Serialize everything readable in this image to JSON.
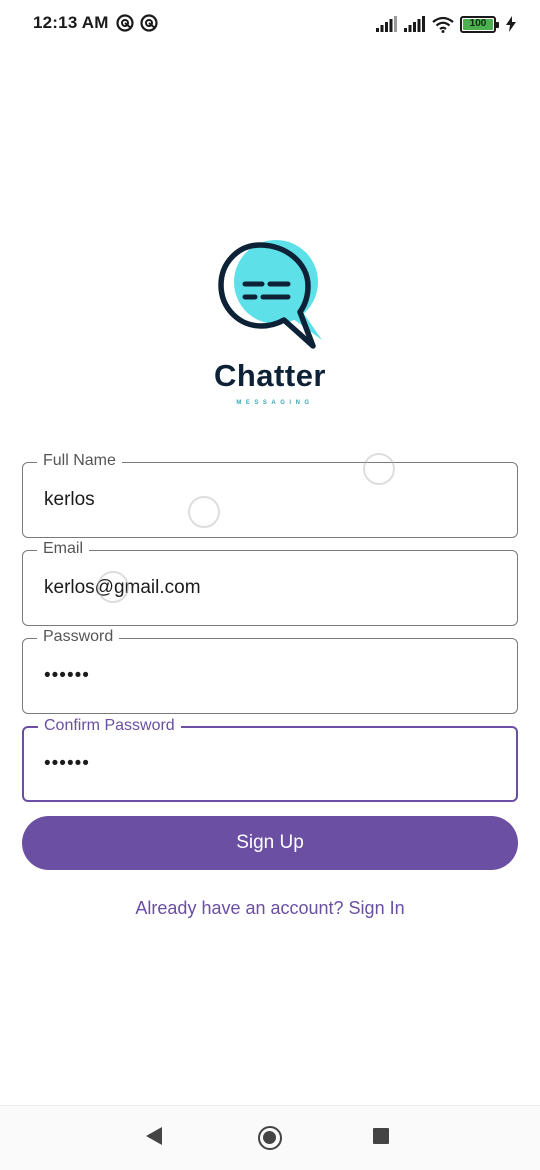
{
  "status_bar": {
    "time": "12:13 AM",
    "battery_level": "100",
    "icons": [
      "notification-icon",
      "notification-icon",
      "signal-icon",
      "signal-icon",
      "wifi-icon",
      "battery-icon",
      "charging-icon"
    ]
  },
  "logo": {
    "name": "Chatter",
    "tagline": "MESSAGING",
    "colors": {
      "bubble": "#5ee0e8",
      "outline": "#0d2236"
    }
  },
  "form": {
    "full_name": {
      "label": "Full Name",
      "value": "kerlos"
    },
    "email": {
      "label": "Email",
      "value": "kerlos@gmail.com"
    },
    "password": {
      "label": "Password",
      "value": "••••••"
    },
    "confirm_password": {
      "label": "Confirm Password",
      "value": "••••••"
    }
  },
  "actions": {
    "sign_up": "Sign Up",
    "sign_in_link": "Already have an account? Sign In"
  },
  "theme": {
    "accent": "#6a4fa3"
  },
  "nav_bar": {
    "icons": [
      "back-icon",
      "home-icon",
      "recents-icon"
    ]
  }
}
